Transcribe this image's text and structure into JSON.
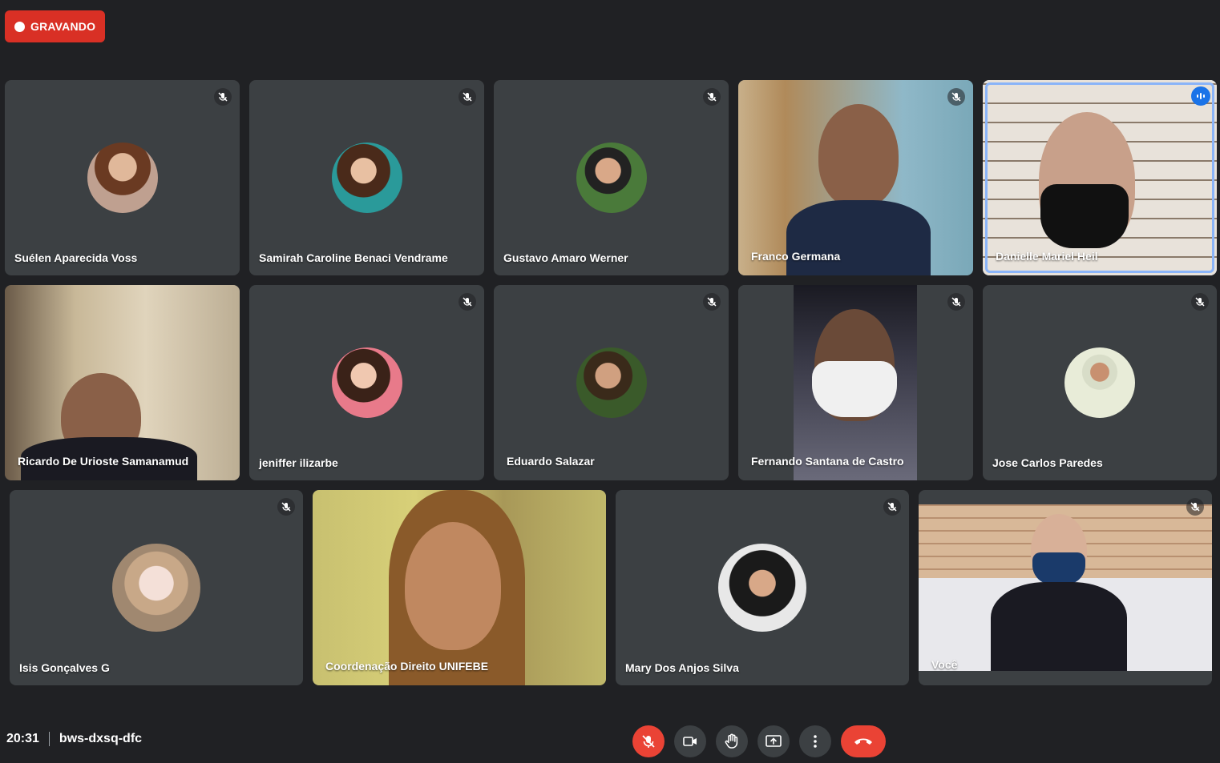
{
  "recording": {
    "label": "GRAVANDO"
  },
  "participants": [
    {
      "name": "Suélen Aparecida Voss"
    },
    {
      "name": "Samirah Caroline Benaci Vendrame"
    },
    {
      "name": "Gustavo Amaro Werner"
    },
    {
      "name": "Franco Germana"
    },
    {
      "name": "Danielle Mariel Heil"
    },
    {
      "name": "Ricardo De Urioste Samanamud"
    },
    {
      "name": "jeniffer ilizarbe"
    },
    {
      "name": "Eduardo Salazar"
    },
    {
      "name": "Fernando Santana de Castro"
    },
    {
      "name": "Jose Carlos Paredes"
    },
    {
      "name": "Isis Gonçalves G"
    },
    {
      "name": "Coordenação Direito UNIFEBE"
    },
    {
      "name": "Mary Dos Anjos Silva"
    },
    {
      "name": "Você"
    }
  ],
  "meeting": {
    "time": "20:31",
    "code": "bws-dxsq-dfc"
  },
  "controls": [
    "mic-off-icon",
    "camera-icon",
    "raise-hand-icon",
    "present-screen-icon",
    "more-options-icon",
    "end-call-icon"
  ],
  "colors": {
    "background": "#202124",
    "tile": "#3c4043",
    "danger": "#ea4335",
    "recording": "#d93025",
    "speaking": "#1a73e8"
  }
}
